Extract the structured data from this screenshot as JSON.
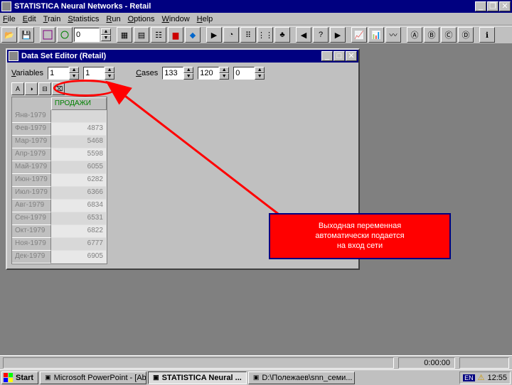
{
  "window": {
    "title": "STATISTICA Neural Networks - Retail"
  },
  "menu": [
    "File",
    "Edit",
    "Train",
    "Statistics",
    "Run",
    "Options",
    "Window",
    "Help"
  ],
  "toolbar_zoom": "0",
  "child": {
    "title": "Data Set Editor (Retail)",
    "variables_label": "Variables",
    "var_a": "1",
    "var_b": "1",
    "cases_label": "Cases",
    "case_a": "133",
    "case_b": "120",
    "case_c": "0",
    "column_header": "ПРОДАЖИ",
    "rows": [
      {
        "label": "Янв-1979",
        "value": ""
      },
      {
        "label": "Фев-1979",
        "value": "4873"
      },
      {
        "label": "Мар-1979",
        "value": "5468"
      },
      {
        "label": "Апр-1979",
        "value": "5598"
      },
      {
        "label": "Май-1979",
        "value": "6055"
      },
      {
        "label": "Июн-1979",
        "value": "6282"
      },
      {
        "label": "Июл-1979",
        "value": "6366"
      },
      {
        "label": "Авг-1979",
        "value": "6834"
      },
      {
        "label": "Сен-1979",
        "value": "6531"
      },
      {
        "label": "Окт-1979",
        "value": "6822"
      },
      {
        "label": "Ноя-1979",
        "value": "6777"
      },
      {
        "label": "Дек-1979",
        "value": "6905"
      }
    ]
  },
  "callout": {
    "line1": "Выходная переменная",
    "line2": "автоматически подается",
    "line3": "на вход сети"
  },
  "status": {
    "elapsed": "0:00:00"
  },
  "taskbar": {
    "start": "Start",
    "tasks": [
      {
        "label": "Microsoft PowerPoint - [Ab...",
        "active": false
      },
      {
        "label": "STATISTICA Neural ...",
        "active": true
      },
      {
        "label": "D:\\Полежаев\\snn_семи...",
        "active": false
      }
    ],
    "lang": "EN",
    "time": "12:55"
  }
}
